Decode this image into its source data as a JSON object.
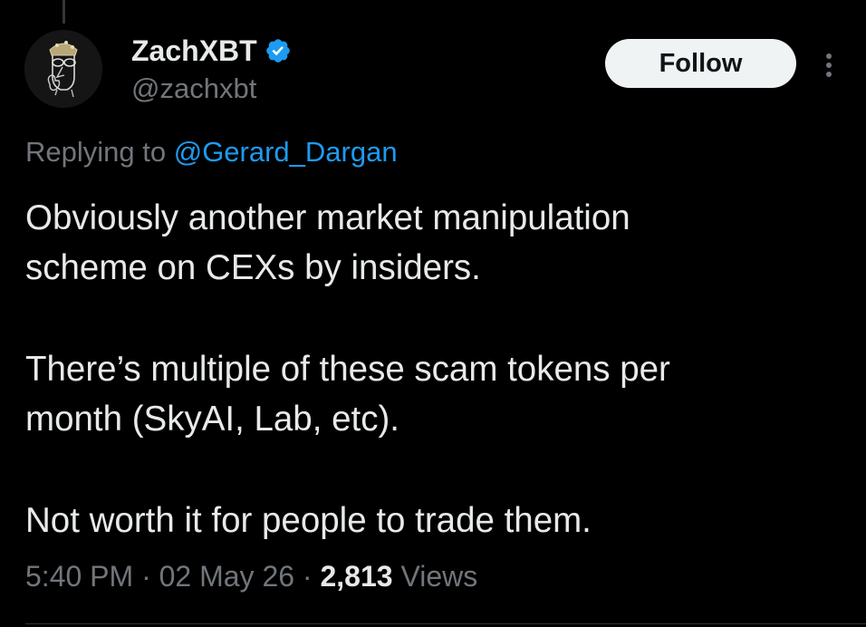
{
  "colors": {
    "background": "#000000",
    "text_primary": "#e7e9ea",
    "text_secondary": "#71767b",
    "accent_link": "#1d9bf0",
    "verified_badge": "#1d9bf0",
    "follow_button_bg": "#eff3f4",
    "follow_button_text": "#0f1419"
  },
  "author": {
    "display_name": "ZachXBT",
    "handle": "@zachxbt",
    "verified_icon": "verified-badge-icon",
    "avatar_icon": "profile-avatar"
  },
  "header": {
    "follow_label": "Follow",
    "more_icon": "more-vertical-icon"
  },
  "reply": {
    "prefix": "Replying to ",
    "target": "@Gerard_Dargan"
  },
  "tweet": {
    "paragraphs": [
      "Obviously another market manipulation\nscheme on CEXs by insiders.",
      "There’s multiple of these scam tokens per\nmonth (SkyAI, Lab, etc).",
      "Not worth it for people to trade them."
    ]
  },
  "meta": {
    "time": "5:40 PM",
    "separator": " · ",
    "date": "02 May 26",
    "views_count": "2,813",
    "views_label": " Views"
  }
}
